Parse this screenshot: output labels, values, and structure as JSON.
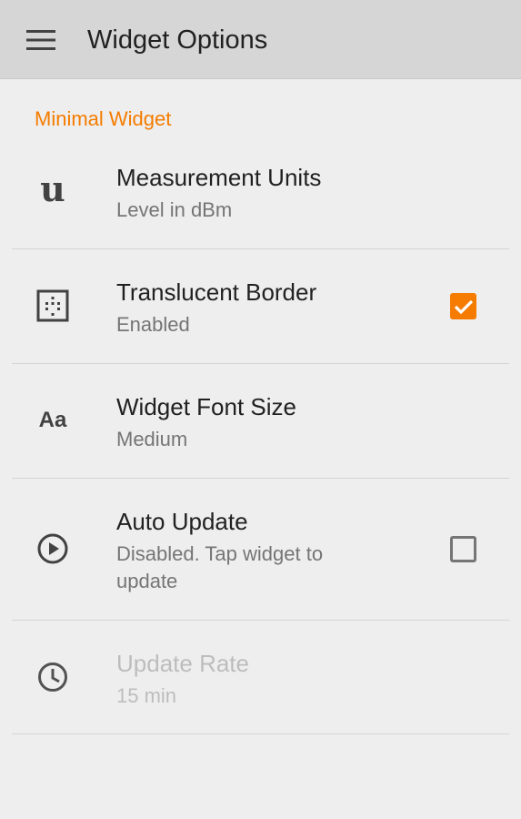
{
  "app_bar": {
    "title": "Widget Options",
    "menu_icon": "hamburger-menu-icon"
  },
  "section": {
    "header": "Minimal Widget"
  },
  "settings": [
    {
      "title": "Measurement Units",
      "summary": "Level in dBm",
      "icon": "units-u-icon",
      "icon_glyph": "u",
      "enabled": true
    },
    {
      "title": "Translucent Border",
      "summary": "Enabled",
      "icon": "dotted-border-icon",
      "checkbox": true,
      "enabled": true
    },
    {
      "title": "Widget Font Size",
      "summary": "Medium",
      "icon": "font-size-icon",
      "icon_glyph": "Aa",
      "enabled": true
    },
    {
      "title": "Auto Update",
      "summary": "Disabled. Tap widget to update",
      "icon": "play-circle-icon",
      "checkbox": false,
      "enabled": true
    },
    {
      "title": "Update Rate",
      "summary": "15 min",
      "icon": "clock-icon",
      "enabled": false
    }
  ],
  "colors": {
    "accent": "#f57c00",
    "app_bar": "#d6d6d6",
    "background": "#eeeeee",
    "primary_text": "#212121",
    "secondary_text": "#757575",
    "disabled_text": "#bdbdbd"
  }
}
